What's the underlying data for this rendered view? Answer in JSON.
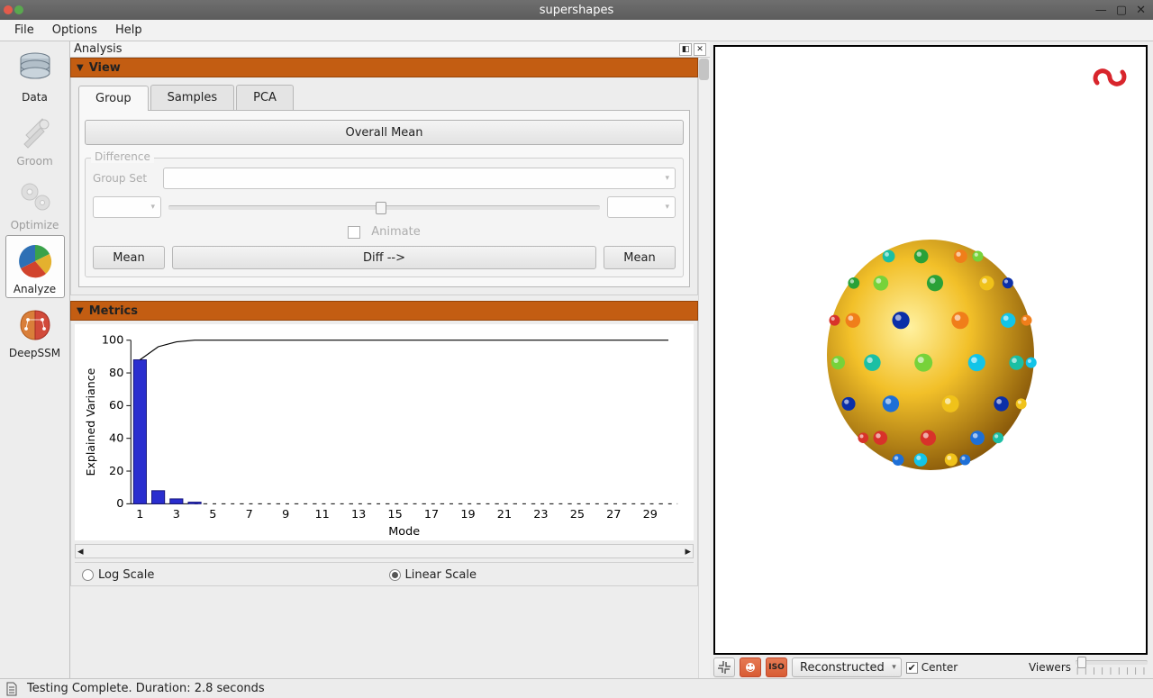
{
  "window": {
    "title": "supershapes"
  },
  "menu": {
    "file": "File",
    "options": "Options",
    "help": "Help"
  },
  "sidebar": {
    "data": "Data",
    "groom": "Groom",
    "optimize": "Optimize",
    "analyze": "Analyze",
    "deepssm": "DeepSSM"
  },
  "dock": {
    "title": "Analysis"
  },
  "view_section": {
    "header": "View",
    "tabs": {
      "group": "Group",
      "samples": "Samples",
      "pca": "PCA"
    },
    "overall_mean": "Overall Mean",
    "difference": {
      "legend": "Difference",
      "group_set": "Group Set",
      "animate": "Animate",
      "mean_left": "Mean",
      "diff": "Diff -->",
      "mean_right": "Mean"
    }
  },
  "metrics_section": {
    "header": "Metrics",
    "ylabel": "Explained Variance",
    "xlabel": "Mode",
    "log": "Log Scale",
    "linear": "Linear Scale"
  },
  "chart_data": {
    "type": "bar",
    "categories": [
      1,
      2,
      3,
      4,
      5,
      6,
      7,
      8,
      9,
      10,
      11,
      12,
      13,
      14,
      15,
      16,
      17,
      18,
      19,
      20,
      21,
      22,
      23,
      24,
      25,
      26,
      27,
      28,
      29,
      30
    ],
    "values": [
      88,
      8,
      3,
      1,
      0,
      0,
      0,
      0,
      0,
      0,
      0,
      0,
      0,
      0,
      0,
      0,
      0,
      0,
      0,
      0,
      0,
      0,
      0,
      0,
      0,
      0,
      0,
      0,
      0,
      0
    ],
    "cumulative": [
      88,
      96,
      99,
      100,
      100,
      100,
      100,
      100,
      100,
      100,
      100,
      100,
      100,
      100,
      100,
      100,
      100,
      100,
      100,
      100,
      100,
      100,
      100,
      100,
      100,
      100,
      100,
      100,
      100,
      100
    ],
    "title": "",
    "xlabel": "Mode",
    "ylabel": "Explained Variance",
    "ylim": [
      0,
      100
    ],
    "yticks": [
      0,
      20,
      40,
      60,
      80,
      100
    ],
    "xticks_shown": [
      1,
      3,
      5,
      7,
      9,
      11,
      13,
      15,
      17,
      19,
      21,
      23,
      25,
      27,
      29
    ]
  },
  "viewer": {
    "dropdown": "Reconstructed",
    "center": "Center",
    "viewers": "Viewers",
    "iso": "ISO"
  },
  "status": {
    "text": "Testing Complete.  Duration: 2.8 seconds"
  }
}
